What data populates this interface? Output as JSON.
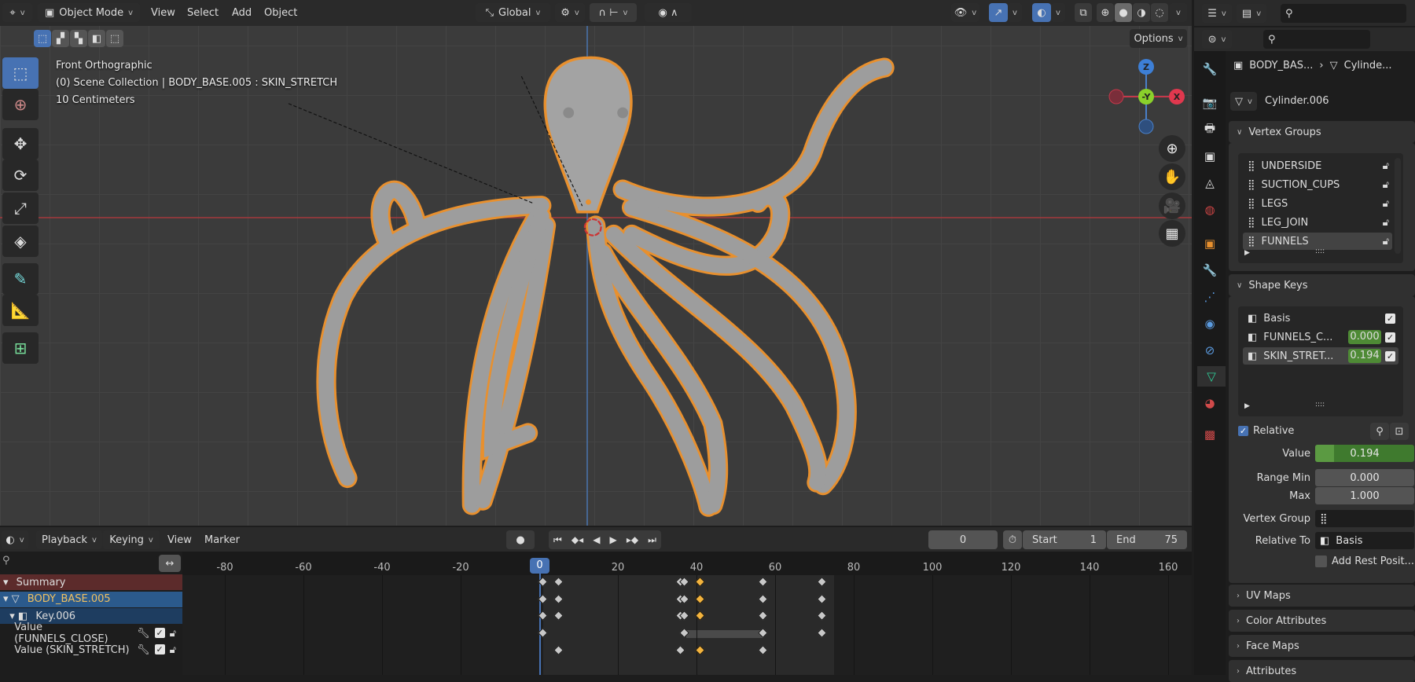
{
  "header": {
    "mode": "Object Mode",
    "menus": [
      "View",
      "Select",
      "Add",
      "Object"
    ],
    "orientation": "Global",
    "options": "Options"
  },
  "viewport": {
    "view_name": "Front Orthographic",
    "collection": "(0) Scene Collection | BODY_BASE.005 : SKIN_STRETCH",
    "scale": "10 Centimeters",
    "gizmo": {
      "z": "Z",
      "y": "-Y",
      "x": "X"
    }
  },
  "tools": [
    "select-box-icon",
    "cursor-icon",
    "move-icon",
    "rotate-icon",
    "scale-icon",
    "transform-icon",
    "annotate-icon",
    "measure-icon",
    "add-cube-icon"
  ],
  "timeline": {
    "menus": [
      "Playback",
      "Keying",
      "View",
      "Marker"
    ],
    "current_frame": "0",
    "start_label": "Start",
    "start": "1",
    "end_label": "End",
    "end": "75",
    "ruler": [
      -80,
      -60,
      -40,
      -20,
      0,
      20,
      40,
      60,
      80,
      100,
      120,
      140,
      160
    ],
    "channels": [
      {
        "label": "Summary",
        "frames": [
          1,
          5,
          36,
          37,
          41,
          57,
          72
        ],
        "selected": [
          41
        ]
      },
      {
        "label": "BODY_BASE.005",
        "frames": [
          1,
          5,
          36,
          37,
          41,
          57,
          72
        ],
        "selected": [
          41
        ]
      },
      {
        "label": "Key.006",
        "frames": [
          1,
          5,
          36,
          37,
          41,
          57,
          72
        ],
        "selected": [
          41
        ]
      },
      {
        "label": "Value (FUNNELS_CLOSE)",
        "frames": [
          1,
          37,
          57,
          72
        ],
        "selected": []
      },
      {
        "label": "Value (SKIN_STRETCH)",
        "frames": [
          5,
          36,
          41,
          57
        ],
        "selected": [
          41
        ]
      }
    ]
  },
  "properties": {
    "breadcrumb": {
      "object": "BODY_BAS...",
      "mesh": "Cylinde..."
    },
    "mesh_name": "Cylinder.006",
    "vertex_groups": {
      "title": "Vertex Groups",
      "items": [
        "UNDERSIDE",
        "SUCTION_CUPS",
        "LEGS",
        "LEG_JOIN",
        "FUNNELS"
      ],
      "active": 4
    },
    "shape_keys": {
      "title": "Shape Keys",
      "items": [
        {
          "name": "Basis",
          "value": null
        },
        {
          "name": "FUNNELS_C...",
          "value": "0.000"
        },
        {
          "name": "SKIN_STRET...",
          "value": "0.194"
        }
      ],
      "active": 2
    },
    "relative": "Relative",
    "value_label": "Value",
    "value": "0.194",
    "value_fraction": 0.194,
    "range_min_label": "Range Min",
    "range_min": "0.000",
    "max_label": "Max",
    "max": "1.000",
    "vertex_group_label": "Vertex Group",
    "relative_to_label": "Relative To",
    "relative_to": "Basis",
    "add_rest": "Add Rest Posit...",
    "collapsed": [
      "UV Maps",
      "Color Attributes",
      "Face Maps",
      "Attributes"
    ]
  },
  "colors": {
    "accent": "#4772b3",
    "selected_key": "#f3b33d",
    "outline": "#e8902e",
    "value_green": "#4e8a35"
  }
}
